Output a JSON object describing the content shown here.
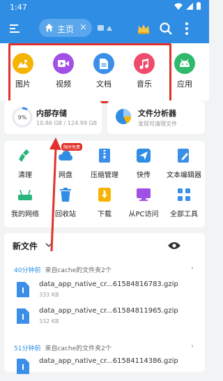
{
  "status": {
    "time": "1:47"
  },
  "topbar": {
    "tab_label": "主页",
    "close_glyph": "×"
  },
  "quick_access": [
    {
      "label": "图片",
      "icon": "image-icon",
      "color": "#f5b400"
    },
    {
      "label": "视频",
      "icon": "video-icon",
      "color": "#a150e6"
    },
    {
      "label": "文档",
      "icon": "document-icon",
      "color": "#3b8fe8"
    },
    {
      "label": "音乐",
      "icon": "music-icon",
      "color": "#ef4c6d"
    },
    {
      "label": "应用",
      "icon": "android-icon",
      "color": "#30b86b"
    }
  ],
  "storage": {
    "title": "内部存储",
    "usage": "10.86 GB / 124.99 GB",
    "percent": "9%",
    "percent_value": 0.09
  },
  "analyzer": {
    "title": "文件分析器",
    "subtitle": "发现可清理文件"
  },
  "tools": [
    {
      "label": "清理",
      "icon": "broom-icon",
      "color": "#26b67a"
    },
    {
      "label": "网盘",
      "icon": "cloud-icon",
      "color": "#2f8de4",
      "badge": "限时免费"
    },
    {
      "label": "压缩管理",
      "icon": "zip-icon",
      "color": "#3b8fe8"
    },
    {
      "label": "快传",
      "icon": "send-icon",
      "color": "#2f8de4"
    },
    {
      "label": "文本编辑器",
      "icon": "edit-icon",
      "color": "#3b8fe8"
    },
    {
      "label": "我的网络",
      "icon": "router-icon",
      "color": "#26b67a"
    },
    {
      "label": "回收站",
      "icon": "trash-icon",
      "color": "#2f8de4"
    },
    {
      "label": "下载",
      "icon": "download-icon",
      "color": "#f5b400"
    },
    {
      "label": "从PC访问",
      "icon": "monitor-icon",
      "color": "#a150e6"
    },
    {
      "label": "全部工具",
      "icon": "grid-icon",
      "color": "#3b8fe8"
    }
  ],
  "new_files": {
    "title": "新文件",
    "groups": [
      {
        "time": "40分钟前",
        "source": "来自cache的文件夹2个",
        "files": [
          {
            "name": "data_app_native_cr...61584816783.gzip",
            "size": "333 KB"
          },
          {
            "name": "data_app_native_cr...61584811965.gzip",
            "size": "332 KB"
          }
        ]
      },
      {
        "time": "51分钟前",
        "source": "来自cache的文件夹2个",
        "files": [
          {
            "name": "data_app_native_cr...61584114386.gzip",
            "size": ""
          }
        ]
      }
    ]
  }
}
